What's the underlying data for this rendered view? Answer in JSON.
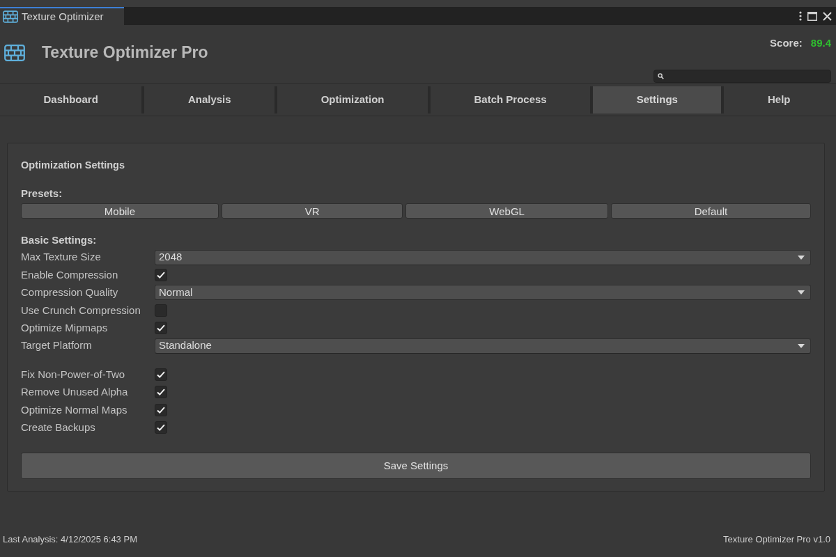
{
  "window": {
    "tab_title": "Texture Optimizer"
  },
  "header": {
    "title": "Texture Optimizer Pro",
    "score_label": "Score:",
    "score_value": "89.4"
  },
  "tabs": [
    {
      "label": "Dashboard",
      "selected": false
    },
    {
      "label": "Analysis",
      "selected": false
    },
    {
      "label": "Optimization",
      "selected": false
    },
    {
      "label": "Batch Process",
      "selected": false
    },
    {
      "label": "Settings",
      "selected": true
    },
    {
      "label": "Help",
      "selected": false
    }
  ],
  "panel": {
    "title": "Optimization Settings",
    "presets_label": "Presets:",
    "presets": [
      "Mobile",
      "VR",
      "WebGL",
      "Default"
    ],
    "groups": [
      {
        "heading": "Basic Settings:",
        "items": [
          {
            "kind": "dropdown",
            "label": "Max Texture Size",
            "value": "2048"
          },
          {
            "kind": "checkbox",
            "label": "Enable Compression",
            "checked": true
          },
          {
            "kind": "dropdown",
            "label": "Compression Quality",
            "value": "Normal"
          },
          {
            "kind": "checkbox",
            "label": "Use Crunch Compression",
            "checked": false
          },
          {
            "kind": "checkbox",
            "label": "Optimize Mipmaps",
            "checked": true
          },
          {
            "kind": "dropdown",
            "label": "Target Platform",
            "value": "Standalone"
          }
        ]
      },
      {
        "items": [
          {
            "kind": "checkbox",
            "label": "Fix Non-Power-of-Two",
            "checked": true
          },
          {
            "kind": "checkbox",
            "label": "Remove Unused Alpha",
            "checked": true
          },
          {
            "kind": "checkbox",
            "label": "Optimize Normal Maps",
            "checked": true
          },
          {
            "kind": "checkbox",
            "label": "Create Backups",
            "checked": true
          }
        ]
      }
    ],
    "save_button": "Save Settings"
  },
  "status_bar": {
    "left": "Last Analysis: 4/12/2025 6:43 PM",
    "right": "Texture Optimizer Pro v1.0"
  }
}
